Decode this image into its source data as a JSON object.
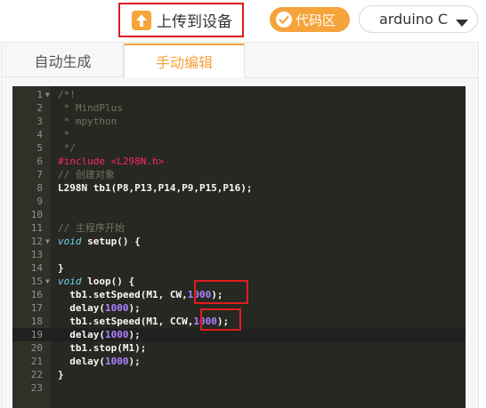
{
  "toolbar": {
    "upload_label": "上传到设备",
    "code_badge_label": "代码区",
    "board_select_value": "arduino C"
  },
  "tabs": [
    {
      "label": "自动生成",
      "active": false
    },
    {
      "label": "手动编辑",
      "active": true
    }
  ],
  "editor": {
    "line_numbers": [
      "1",
      "2",
      "3",
      "4",
      "5",
      "6",
      "7",
      "8",
      "9",
      "10",
      "11",
      "12",
      "13",
      "14",
      "15",
      "16",
      "17",
      "18",
      "19",
      "20",
      "21",
      "22",
      "23"
    ],
    "lines": {
      "l1": "/*!",
      "l2": " * MindPlus",
      "l3": " * mpython",
      "l4": " *",
      "l5": " */",
      "l6a": "#include ",
      "l6b": "<L298N.h>",
      "l7": "// 创建对象",
      "l8": "L298N tb1(P8,P13,P14,P9,P15,P16);",
      "l11": "// 主程序开始",
      "l12a": "void",
      "l12b": " setup() {",
      "l14": "}",
      "l15a": "void",
      "l15b": " loop() {",
      "l16a": "  tb1.setSpeed(M1, CW,",
      "l16b": "1000",
      "l16c": ");",
      "l17a": "  delay(",
      "l17b": "1000",
      "l17c": ");",
      "l18a": "  tb1.setSpeed(M1, CCW,",
      "l18b": "1000",
      "l18c": ");",
      "l19a": "  delay(",
      "l19b": "1000",
      "l19c": ");",
      "l20": "  tb1.stop(M1);",
      "l21a": "  delay(",
      "l21b": "1000",
      "l21c": ");",
      "l22": "}"
    }
  },
  "colors": {
    "accent": "#f5a33b",
    "highlight_box": "#e01d1d",
    "editor_bg": "#272822"
  }
}
